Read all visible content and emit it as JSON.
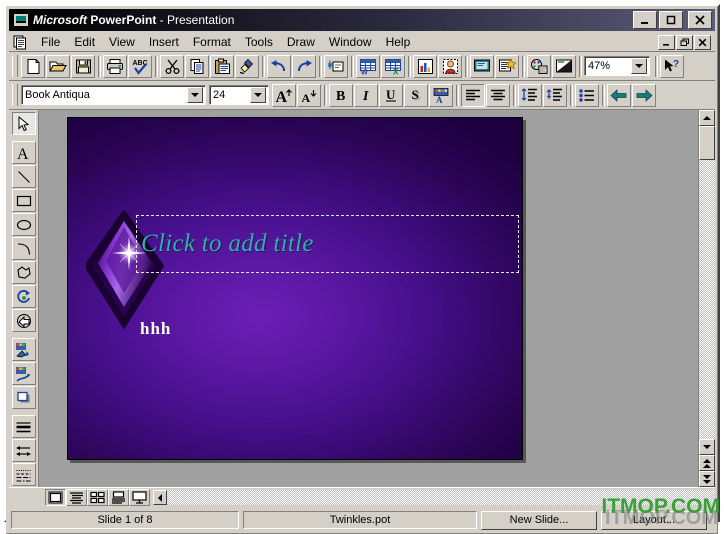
{
  "window": {
    "title_brand": "Microsoft",
    "title_app": " PowerPoint",
    "title_doc": " - Presentation",
    "icon": "powerpoint-icon",
    "minimize_label": "_",
    "maximize_label": "❐",
    "close_label": "✕"
  },
  "menubar": {
    "doc_icon": "document-icon",
    "items": [
      {
        "label": "File"
      },
      {
        "label": "Edit"
      },
      {
        "label": "View"
      },
      {
        "label": "Insert"
      },
      {
        "label": "Format"
      },
      {
        "label": "Tools"
      },
      {
        "label": "Draw"
      },
      {
        "label": "Window"
      },
      {
        "label": "Help"
      }
    ],
    "doc_minimize": "_",
    "doc_restore": "❐",
    "doc_close": "✕"
  },
  "standard_toolbar": {
    "buttons": [
      {
        "name": "new-icon",
        "tip": "New"
      },
      {
        "name": "open-icon",
        "tip": "Open"
      },
      {
        "name": "save-icon",
        "tip": "Save"
      },
      {
        "name": "print-icon",
        "tip": "Print"
      },
      {
        "name": "spelling-icon",
        "tip": "Spelling"
      },
      {
        "name": "cut-icon",
        "tip": "Cut"
      },
      {
        "name": "copy-icon",
        "tip": "Copy"
      },
      {
        "name": "paste-icon",
        "tip": "Paste"
      },
      {
        "name": "format-painter-icon",
        "tip": "Format Painter"
      },
      {
        "name": "undo-icon",
        "tip": "Undo"
      },
      {
        "name": "redo-icon",
        "tip": "Redo"
      },
      {
        "name": "insert-hyperlink-icon",
        "tip": "Insert Hyperlink"
      },
      {
        "name": "insert-word-table-icon",
        "tip": "Insert Microsoft Word Table"
      },
      {
        "name": "insert-excel-worksheet-icon",
        "tip": "Insert Microsoft Excel Worksheet"
      },
      {
        "name": "insert-chart-icon",
        "tip": "Insert Chart"
      },
      {
        "name": "insert-clip-art-icon",
        "tip": "Insert Clip Art"
      },
      {
        "name": "new-slide-icon",
        "tip": "New Slide"
      },
      {
        "name": "slide-layout-icon",
        "tip": "Slide Layout"
      },
      {
        "name": "apply-design-icon",
        "tip": "Apply Design"
      },
      {
        "name": "black-and-white-icon",
        "tip": "Black and White View"
      }
    ],
    "zoom": {
      "value": "47%",
      "name": "zoom-combo"
    },
    "help_button": {
      "name": "help-arrow-icon",
      "label": "?"
    }
  },
  "formatting_toolbar": {
    "font": {
      "value": "Book Antiqua",
      "name": "font-name-combo"
    },
    "size": {
      "value": "24",
      "name": "font-size-combo"
    },
    "buttons": [
      {
        "name": "increase-font-size-icon",
        "label": "A"
      },
      {
        "name": "decrease-font-size-icon",
        "label": "A"
      },
      {
        "name": "bold-icon",
        "label": "B"
      },
      {
        "name": "italic-icon",
        "label": "I"
      },
      {
        "name": "underline-icon",
        "label": "U"
      },
      {
        "name": "text-shadow-icon",
        "label": "S"
      },
      {
        "name": "text-color-icon",
        "label": "A"
      },
      {
        "name": "align-left-icon",
        "label": ""
      },
      {
        "name": "align-center-icon",
        "label": ""
      },
      {
        "name": "line-spacing-icon",
        "label": ""
      },
      {
        "name": "paragraph-spacing-icon",
        "label": ""
      },
      {
        "name": "bullets-icon",
        "label": ""
      },
      {
        "name": "promote-icon",
        "label": ""
      },
      {
        "name": "demote-icon",
        "label": ""
      }
    ]
  },
  "drawing_toolbar": {
    "buttons": [
      {
        "name": "select-arrow-icon",
        "pressed": true
      },
      {
        "name": "text-tool-icon",
        "pressed": false
      },
      {
        "name": "line-tool-icon",
        "pressed": false
      },
      {
        "name": "rectangle-tool-icon",
        "pressed": false
      },
      {
        "name": "ellipse-tool-icon",
        "pressed": false
      },
      {
        "name": "arc-tool-icon",
        "pressed": false
      },
      {
        "name": "freeform-tool-icon",
        "pressed": false
      },
      {
        "name": "free-rotate-icon",
        "pressed": false
      },
      {
        "name": "autoshapes-icon",
        "pressed": false
      },
      {
        "name": "fill-color-icon",
        "pressed": false
      },
      {
        "name": "line-color-icon",
        "pressed": false
      },
      {
        "name": "shadow-icon",
        "pressed": false
      },
      {
        "name": "line-style-icon",
        "pressed": false
      },
      {
        "name": "arrowhead-style-icon",
        "pressed": false
      },
      {
        "name": "dash-style-icon",
        "pressed": false
      }
    ]
  },
  "slide": {
    "title_placeholder": "Click to add title",
    "body_text": "hhh",
    "theme_name": "Twinkles",
    "background_colors": {
      "center": "#6a1fb5",
      "mid": "#4a1190",
      "edge": "#1e0040"
    },
    "title_color": "#2bb0b0",
    "body_color": "#ffffff"
  },
  "scrollbars": {
    "up_arrow": "scroll-up-icon",
    "down_arrow": "scroll-down-icon",
    "prev_slide": "previous-slide-icon",
    "next_slide": "next-slide-icon",
    "left_arrow": "scroll-left-icon"
  },
  "view_buttons": [
    {
      "name": "slide-view-button",
      "pressed": true
    },
    {
      "name": "outline-view-button",
      "pressed": false
    },
    {
      "name": "slide-sorter-view-button",
      "pressed": false
    },
    {
      "name": "notes-page-view-button",
      "pressed": false
    },
    {
      "name": "slide-show-button",
      "pressed": false
    }
  ],
  "statusbar": {
    "slide_counter": "Slide 1 of 8",
    "template_name": "Twinkles.pot",
    "new_slide_button": "New Slide...",
    "layout_button": "Layout..."
  },
  "watermark": {
    "text": "ITMOP.COM"
  }
}
